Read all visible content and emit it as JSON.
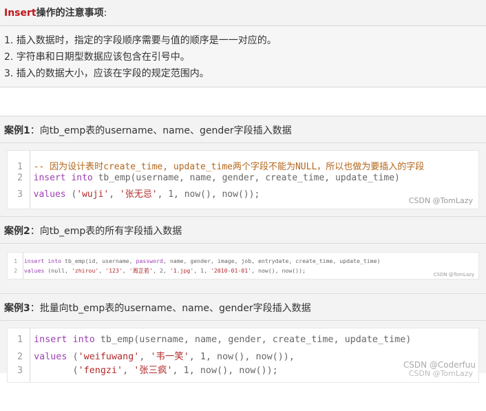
{
  "header": {
    "keyword": "Insert",
    "title_rest": "操作的注意事项",
    "colon": ":"
  },
  "notes": [
    "1. 插入数据时，指定的字段顺序需要与值的顺序是一一对应的。",
    "2. 字符串和日期型数据应该包含在引号中。",
    "3. 插入的数据大小，应该在字段的规定范围内。"
  ],
  "case1": {
    "label": "案例1",
    "title": "：向tb_emp表的username、name、gender字段插入数据",
    "lines": [
      {
        "n": "1",
        "comment": "-- 因为设计表时create_time, update_time两个字段不能为NULL，所以也做为要插入的字段"
      },
      {
        "n": "2",
        "kw": "insert into",
        "plain": " tb_emp(username, name, gender, create_time, update_time)"
      },
      {
        "n": "3",
        "kw": "values",
        "p1": " (",
        "s1": "'wuji'",
        "p2": ", ",
        "s2": "'张无忌'",
        "p3": ", 1, now(), now());"
      }
    ],
    "watermark": "CSDN @TomLazy"
  },
  "case2": {
    "label": "案例2",
    "title": "：向tb_emp表的所有字段插入数据",
    "lines": [
      {
        "n": "1",
        "kw1": "insert",
        "sp": " ",
        "kw2": "into",
        "a": " tb_emp(id, username, ",
        "kw3": "password",
        "b": ", name, gender, image, job, entrydate, create_time, update_time)"
      },
      {
        "n": "2",
        "kw": "values",
        "a": " (null, ",
        "s1": "'zhirou'",
        "b": ", ",
        "s2": "'123'",
        "c": ", ",
        "s3": "'周芷若'",
        "d": ", 2, ",
        "s4": "'1.jpg'",
        "e": ", 1, ",
        "s5": "'2010-01-01'",
        "f": ", now(), now());"
      }
    ],
    "watermark": "CSDN @TomLazy"
  },
  "case3": {
    "label": "案例3",
    "title": "：批量向tb_emp表的username、name、gender字段插入数据",
    "lines": [
      {
        "n": "1",
        "kw": "insert into",
        "plain": " tb_emp(username, name, gender, create_time, update_time)"
      },
      {
        "n": "2",
        "kw": "values",
        "p1": " (",
        "s1": "'weifuwang'",
        "p2": ", ",
        "s2": "'韦一笑'",
        "p3": ", 1, now(), now()),"
      },
      {
        "n": "3",
        "pad": "       (",
        "s1": "'fengzi'",
        "p2": ", ",
        "s2": "'张三疯'",
        "p3": ", 1, now(), now());"
      }
    ],
    "watermark1": "CSDN @Coderfuu",
    "watermark2": "CSDN @TomLazy"
  }
}
